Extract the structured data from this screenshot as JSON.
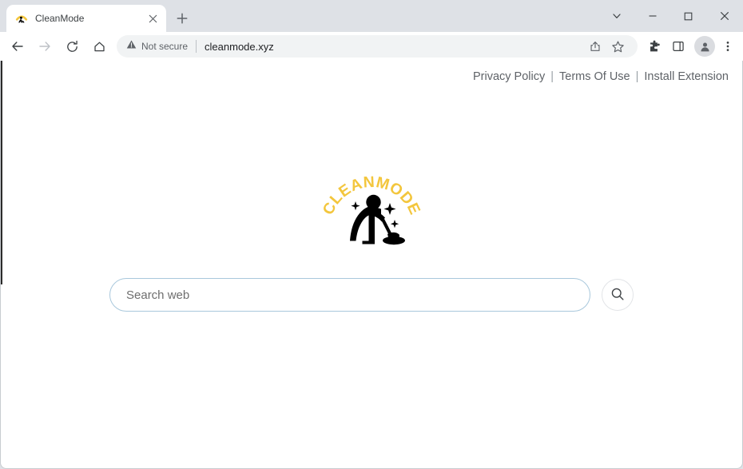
{
  "browser": {
    "tab": {
      "title": "CleanMode",
      "favicon_icon": "cleanmode-favicon",
      "close_icon": "close-icon"
    },
    "new_tab_icon": "plus-icon",
    "window_controls": {
      "tab_search_icon": "chevron-down-icon",
      "minimize_icon": "minimize-icon",
      "maximize_icon": "maximize-icon",
      "close_icon": "close-icon"
    },
    "toolbar": {
      "back_icon": "back-arrow-icon",
      "forward_icon": "forward-arrow-icon",
      "reload_icon": "reload-icon",
      "home_icon": "home-icon",
      "security_icon": "warning-triangle-icon",
      "security_label": "Not secure",
      "url": "cleanmode.xyz",
      "share_icon": "share-icon",
      "bookmark_icon": "star-icon",
      "extensions_icon": "puzzle-icon",
      "side_panel_icon": "side-panel-icon",
      "profile_icon": "avatar-icon",
      "menu_icon": "three-dot-menu-icon"
    }
  },
  "page": {
    "top_links": [
      {
        "label": "Privacy Policy"
      },
      {
        "label": "Terms Of Use"
      },
      {
        "label": "Install Extension"
      }
    ],
    "link_separator": "|",
    "logo": {
      "brand_text": "CLEANMODE",
      "brand_color": "#F3C63D",
      "figure_color": "#000000",
      "icon": "cleaner-vacuum-logo",
      "sparkle_icon": "sparkle-icon"
    },
    "search": {
      "placeholder": "Search web",
      "value": "",
      "button_icon": "search-icon",
      "border_color": "#a9c8dc"
    }
  }
}
